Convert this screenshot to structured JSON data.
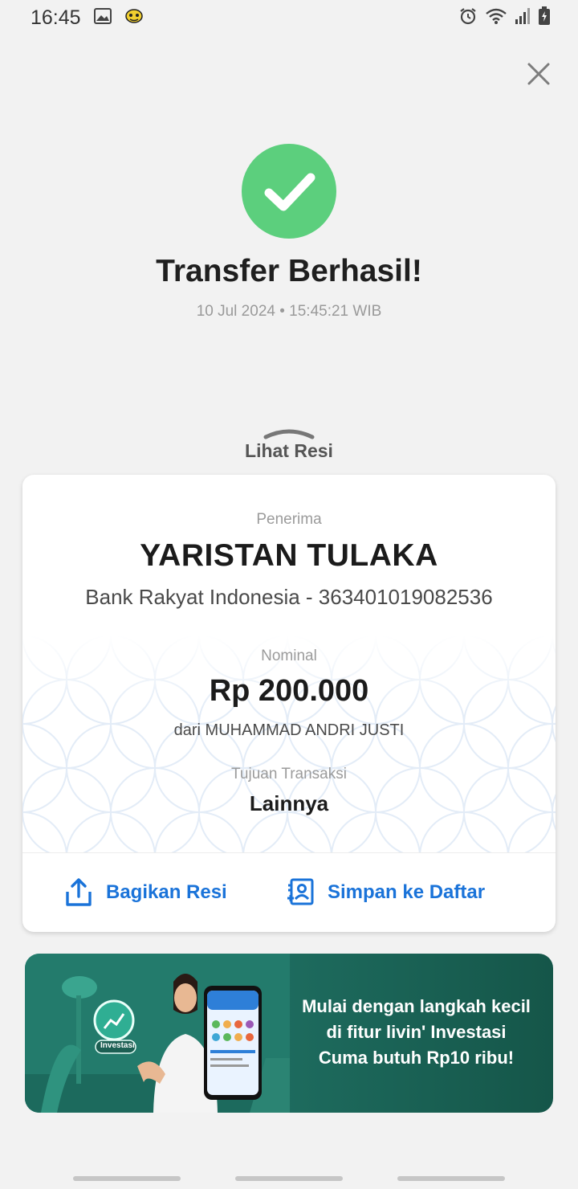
{
  "status_bar": {
    "time": "16:45",
    "left_icons": [
      "gallery-icon",
      "notification-app-icon"
    ],
    "right_icons": [
      "alarm-icon",
      "wifi-icon",
      "signal-icon",
      "battery-charging-icon"
    ]
  },
  "header": {
    "close_icon": "close-icon"
  },
  "result": {
    "status_icon": "check-circle-icon",
    "status_color": "#5ccf7d",
    "title": "Transfer Berhasil!",
    "timestamp": "10 Jul 2024 • 15:45:21 WIB"
  },
  "receipt_toggle": {
    "label": "Lihat Resi",
    "icon": "chevron-up-icon"
  },
  "receipt": {
    "recipient_label": "Penerima",
    "recipient_name": "YARISTAN TULAKA",
    "recipient_bank": "Bank Rakyat Indonesia - 363401019082536",
    "amount_label": "Nominal",
    "amount": "Rp 200.000",
    "from_text": "dari MUHAMMAD ANDRI JUSTI",
    "purpose_label": "Tujuan Transaksi",
    "purpose": "Lainnya",
    "actions": {
      "share_label": "Bagikan Resi",
      "save_label": "Simpan ke Daftar"
    },
    "accent_color": "#1a73d9"
  },
  "promo": {
    "lines": [
      "Mulai dengan langkah kecil",
      "di fitur livin' Investasi",
      "Cuma butuh Rp10 ribu!"
    ],
    "badge": "Investasi",
    "background_color": "#1f6f62"
  }
}
